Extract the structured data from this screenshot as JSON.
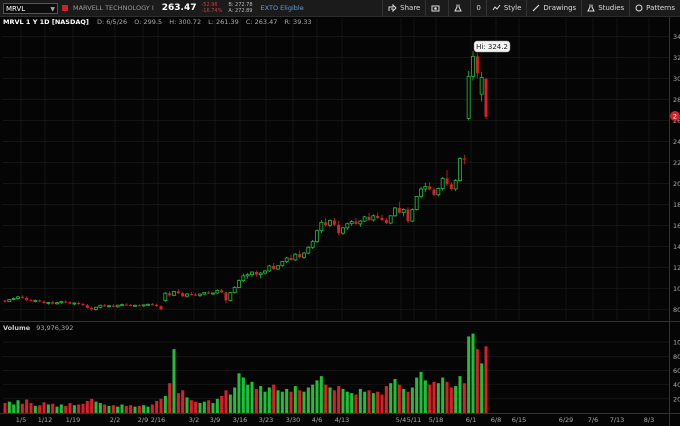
{
  "toolbar": {
    "symbol": "MRVL",
    "company": "MARVELL TECHNOLOGY I",
    "last_price": "263.47",
    "change": "-52.96",
    "change_pct": "-16.74%",
    "bid": "B: 272.78",
    "ask": "A: 272.89",
    "exto": "EXTO Eligible",
    "share_label": "Share",
    "zero_value": "0",
    "style_label": "Style",
    "drawings_label": "Drawings",
    "studies_label": "Studies",
    "patterns_label": "Patterns"
  },
  "info": {
    "title": "MRVL 1 Y 1D [NASDAQ]",
    "date": "D: 6/5/26",
    "open": "O: 299.5",
    "high": "H: 300.72",
    "low": "L: 261.39",
    "close": "C: 263.47",
    "range": "R: 39.33"
  },
  "annotations": {
    "hi_label": "Hi: 324.2",
    "last_marker": "2"
  },
  "volume": {
    "label": "Volume",
    "value": "93,976,392"
  },
  "chart_data": {
    "type": "candlestick",
    "x_tick_labels": [
      "1/5",
      "1/12",
      "1/19",
      "2/2",
      "2/9",
      "2/16",
      "3/2",
      "3/9",
      "3/16",
      "3/23",
      "3/30",
      "4/6",
      "4/13",
      "5/4",
      "5/11",
      "5/18",
      "6/1",
      "6/8",
      "6/15",
      "6/29",
      "7/6",
      "7/13",
      "8/3"
    ],
    "y_tick_labels_price": [
      "80",
      "100",
      "120",
      "140",
      "160",
      "180",
      "200",
      "220",
      "240",
      "260",
      "280",
      "300",
      "320",
      "340"
    ],
    "y_tick_labels_volume": [
      "20",
      "40",
      "60",
      "80",
      "100"
    ],
    "price_ylim": [
      70,
      348
    ],
    "volume_ylim": [
      0,
      110
    ],
    "colors": {
      "up": "#1fbf3a",
      "down": "#d7202a",
      "background": "#050505",
      "grid": "#2a2a2a"
    },
    "candles": [
      [
        88.6,
        89,
        86.5,
        87.5,
        14
      ],
      [
        87.5,
        90,
        87,
        89.5,
        16
      ],
      [
        89.5,
        91.5,
        88.7,
        90.5,
        12
      ],
      [
        90.5,
        93,
        89.6,
        92,
        18
      ],
      [
        92,
        93.5,
        90.5,
        91,
        13
      ],
      [
        91,
        92.5,
        88,
        89,
        19
      ],
      [
        89,
        90,
        87.5,
        88,
        14
      ],
      [
        88,
        89.5,
        86.7,
        88.5,
        10
      ],
      [
        88.5,
        89.6,
        87,
        87.5,
        11
      ],
      [
        87.5,
        88.5,
        85.6,
        86.2,
        15
      ],
      [
        86.2,
        87.3,
        84.6,
        86.8,
        12
      ],
      [
        86.8,
        88,
        84.8,
        85.5,
        13
      ],
      [
        85.5,
        87,
        84.4,
        86.5,
        9
      ],
      [
        86.5,
        88.2,
        85.4,
        87.6,
        12
      ],
      [
        87.6,
        88.8,
        86,
        86.8,
        10
      ],
      [
        86.8,
        87.9,
        85.1,
        85.6,
        14
      ],
      [
        85.6,
        86.8,
        84.1,
        86.2,
        11
      ],
      [
        86.2,
        87.5,
        84.6,
        85.1,
        12
      ],
      [
        85.1,
        86.3,
        83.6,
        84.1,
        13
      ],
      [
        84.1,
        85.3,
        80.8,
        81.6,
        17
      ],
      [
        81.6,
        82.6,
        78.8,
        80.1,
        20
      ],
      [
        80.1,
        82.6,
        79.1,
        82.1,
        16
      ],
      [
        82.1,
        84.6,
        81.1,
        84,
        14
      ],
      [
        84,
        85.3,
        82.5,
        83.2,
        12
      ],
      [
        83.2,
        84.4,
        81.6,
        83.6,
        10
      ],
      [
        83.6,
        84.8,
        82.1,
        82.6,
        11
      ],
      [
        82.6,
        84.6,
        81.6,
        84.1,
        9
      ],
      [
        84.1,
        85.6,
        83.1,
        84.6,
        12
      ],
      [
        84.6,
        85.8,
        83.6,
        84.2,
        10
      ],
      [
        84.2,
        85.3,
        82.8,
        83.5,
        11
      ],
      [
        83.5,
        84.8,
        82.6,
        84,
        9
      ],
      [
        84,
        85.1,
        83,
        83.6,
        10
      ],
      [
        83.6,
        84.8,
        82.5,
        84.4,
        11
      ],
      [
        84.4,
        85.6,
        83.2,
        85,
        9
      ],
      [
        85,
        86.2,
        83.8,
        84.5,
        12
      ],
      [
        84.5,
        85.6,
        82.5,
        83.2,
        17
      ],
      [
        83.2,
        84,
        79.2,
        80.2,
        20
      ],
      [
        88.5,
        96.5,
        87.2,
        95.5,
        24
      ],
      [
        95.5,
        97.5,
        92.2,
        93.5,
        42
      ],
      [
        93.5,
        98,
        92.7,
        97.2,
        90
      ],
      [
        97.2,
        99.2,
        94.7,
        95.5,
        28
      ],
      [
        95.5,
        96.5,
        91.7,
        92.7,
        32
      ],
      [
        92.7,
        95.7,
        91.2,
        94.7,
        22
      ],
      [
        94.7,
        96.7,
        93.2,
        94.2,
        18
      ],
      [
        94.2,
        95.9,
        92.7,
        93.5,
        16
      ],
      [
        93.5,
        95.2,
        91.9,
        94.7,
        14
      ],
      [
        94.7,
        96.7,
        93.7,
        96.2,
        16
      ],
      [
        96.2,
        97.7,
        94.7,
        95.2,
        18
      ],
      [
        95.2,
        96.2,
        93.7,
        95.7,
        14
      ],
      [
        95.7,
        99.2,
        94.9,
        98.2,
        20
      ],
      [
        98.2,
        99.7,
        95.9,
        96.2,
        24
      ],
      [
        96.2,
        97.2,
        86.2,
        88.7,
        32
      ],
      [
        88.7,
        96.7,
        87.7,
        96,
        26
      ],
      [
        96,
        102.2,
        95.2,
        101,
        36
      ],
      [
        101,
        108.7,
        100.2,
        107.5,
        56
      ],
      [
        107.5,
        114.2,
        106.2,
        112,
        50
      ],
      [
        112,
        114.7,
        109.2,
        113.2,
        40
      ],
      [
        113.2,
        116.2,
        110.7,
        115.7,
        44
      ],
      [
        115.7,
        117.2,
        111.2,
        113.2,
        34
      ],
      [
        113.2,
        115.7,
        109.7,
        114.7,
        38
      ],
      [
        114.7,
        117.7,
        113.2,
        116.7,
        30
      ],
      [
        116.7,
        122.7,
        115.7,
        121.5,
        36
      ],
      [
        121.5,
        124.2,
        117.7,
        118.5,
        40
      ],
      [
        118.5,
        122.2,
        117.2,
        121.7,
        32
      ],
      [
        121.7,
        126.2,
        120.7,
        125.7,
        30
      ],
      [
        125.7,
        130.2,
        124.2,
        129,
        34
      ],
      [
        129,
        132.2,
        126.7,
        127.2,
        30
      ],
      [
        127.2,
        133.7,
        126.2,
        132.7,
        38
      ],
      [
        132.7,
        136.2,
        128.7,
        129.7,
        32
      ],
      [
        129.7,
        134.7,
        128.2,
        133.7,
        30
      ],
      [
        133.7,
        140.2,
        132.7,
        139.2,
        36
      ],
      [
        139.2,
        146.2,
        137.7,
        144.7,
        40
      ],
      [
        144.7,
        156.2,
        143.2,
        155,
        46
      ],
      [
        155,
        165.2,
        152.7,
        163,
        52
      ],
      [
        163,
        167.2,
        158.7,
        160.2,
        40
      ],
      [
        160.2,
        165.7,
        158.2,
        164.7,
        36
      ],
      [
        164.7,
        167.2,
        159.2,
        160.7,
        32
      ],
      [
        160.7,
        164.2,
        150.7,
        152.7,
        38
      ],
      [
        152.7,
        158.7,
        151.2,
        157.7,
        34
      ],
      [
        157.7,
        162.7,
        155.7,
        161.7,
        30
      ],
      [
        161.7,
        165.2,
        159.7,
        163.7,
        28
      ],
      [
        163.7,
        167.2,
        160.7,
        161.5,
        26
      ],
      [
        161.5,
        165.2,
        158.7,
        164.2,
        34
      ],
      [
        164.2,
        169.2,
        163.2,
        168.2,
        30
      ],
      [
        168.2,
        171.7,
        164.2,
        165.2,
        32
      ],
      [
        165.2,
        170.7,
        163.7,
        169.2,
        28
      ],
      [
        169.2,
        172.2,
        166.2,
        167.2,
        30
      ],
      [
        167.2,
        170.2,
        164.2,
        165.2,
        26
      ],
      [
        165.2,
        167.2,
        161.2,
        162.2,
        38
      ],
      [
        162.2,
        169.7,
        161.2,
        169.2,
        42
      ],
      [
        169.2,
        177.7,
        168.2,
        176.7,
        48
      ],
      [
        176.7,
        182.7,
        171.2,
        172.2,
        40
      ],
      [
        172.2,
        176.2,
        168.7,
        175.2,
        34
      ],
      [
        175.2,
        177.2,
        162.2,
        164.2,
        30
      ],
      [
        164.2,
        176.2,
        163.2,
        175.2,
        36
      ],
      [
        175.2,
        188.2,
        174.2,
        187.7,
        50
      ],
      [
        187.7,
        196.7,
        185.7,
        194.7,
        58
      ],
      [
        194.7,
        200.7,
        191.7,
        197.2,
        46
      ],
      [
        197.2,
        201.2,
        193.7,
        194.2,
        40
      ],
      [
        194.2,
        196.2,
        187.7,
        189.2,
        44
      ],
      [
        189.2,
        196.2,
        187.7,
        195.2,
        42
      ],
      [
        195.2,
        206.2,
        193.2,
        204.7,
        50
      ],
      [
        204.7,
        212.7,
        197.7,
        199.2,
        44
      ],
      [
        199.2,
        201.2,
        193.2,
        194.7,
        36
      ],
      [
        194.7,
        204.2,
        192.7,
        202.7,
        38
      ],
      [
        202.7,
        225.2,
        201.7,
        223.7,
        52
      ],
      [
        223.7,
        227.2,
        218.2,
        222.7,
        42
      ],
      [
        262,
        307,
        260,
        302,
        108
      ],
      [
        302,
        326,
        298,
        321,
        112
      ],
      [
        321,
        324.2,
        300,
        305,
        90
      ],
      [
        285,
        306,
        278,
        301,
        70
      ],
      [
        299.5,
        300.72,
        261.39,
        263.47,
        94
      ]
    ]
  }
}
